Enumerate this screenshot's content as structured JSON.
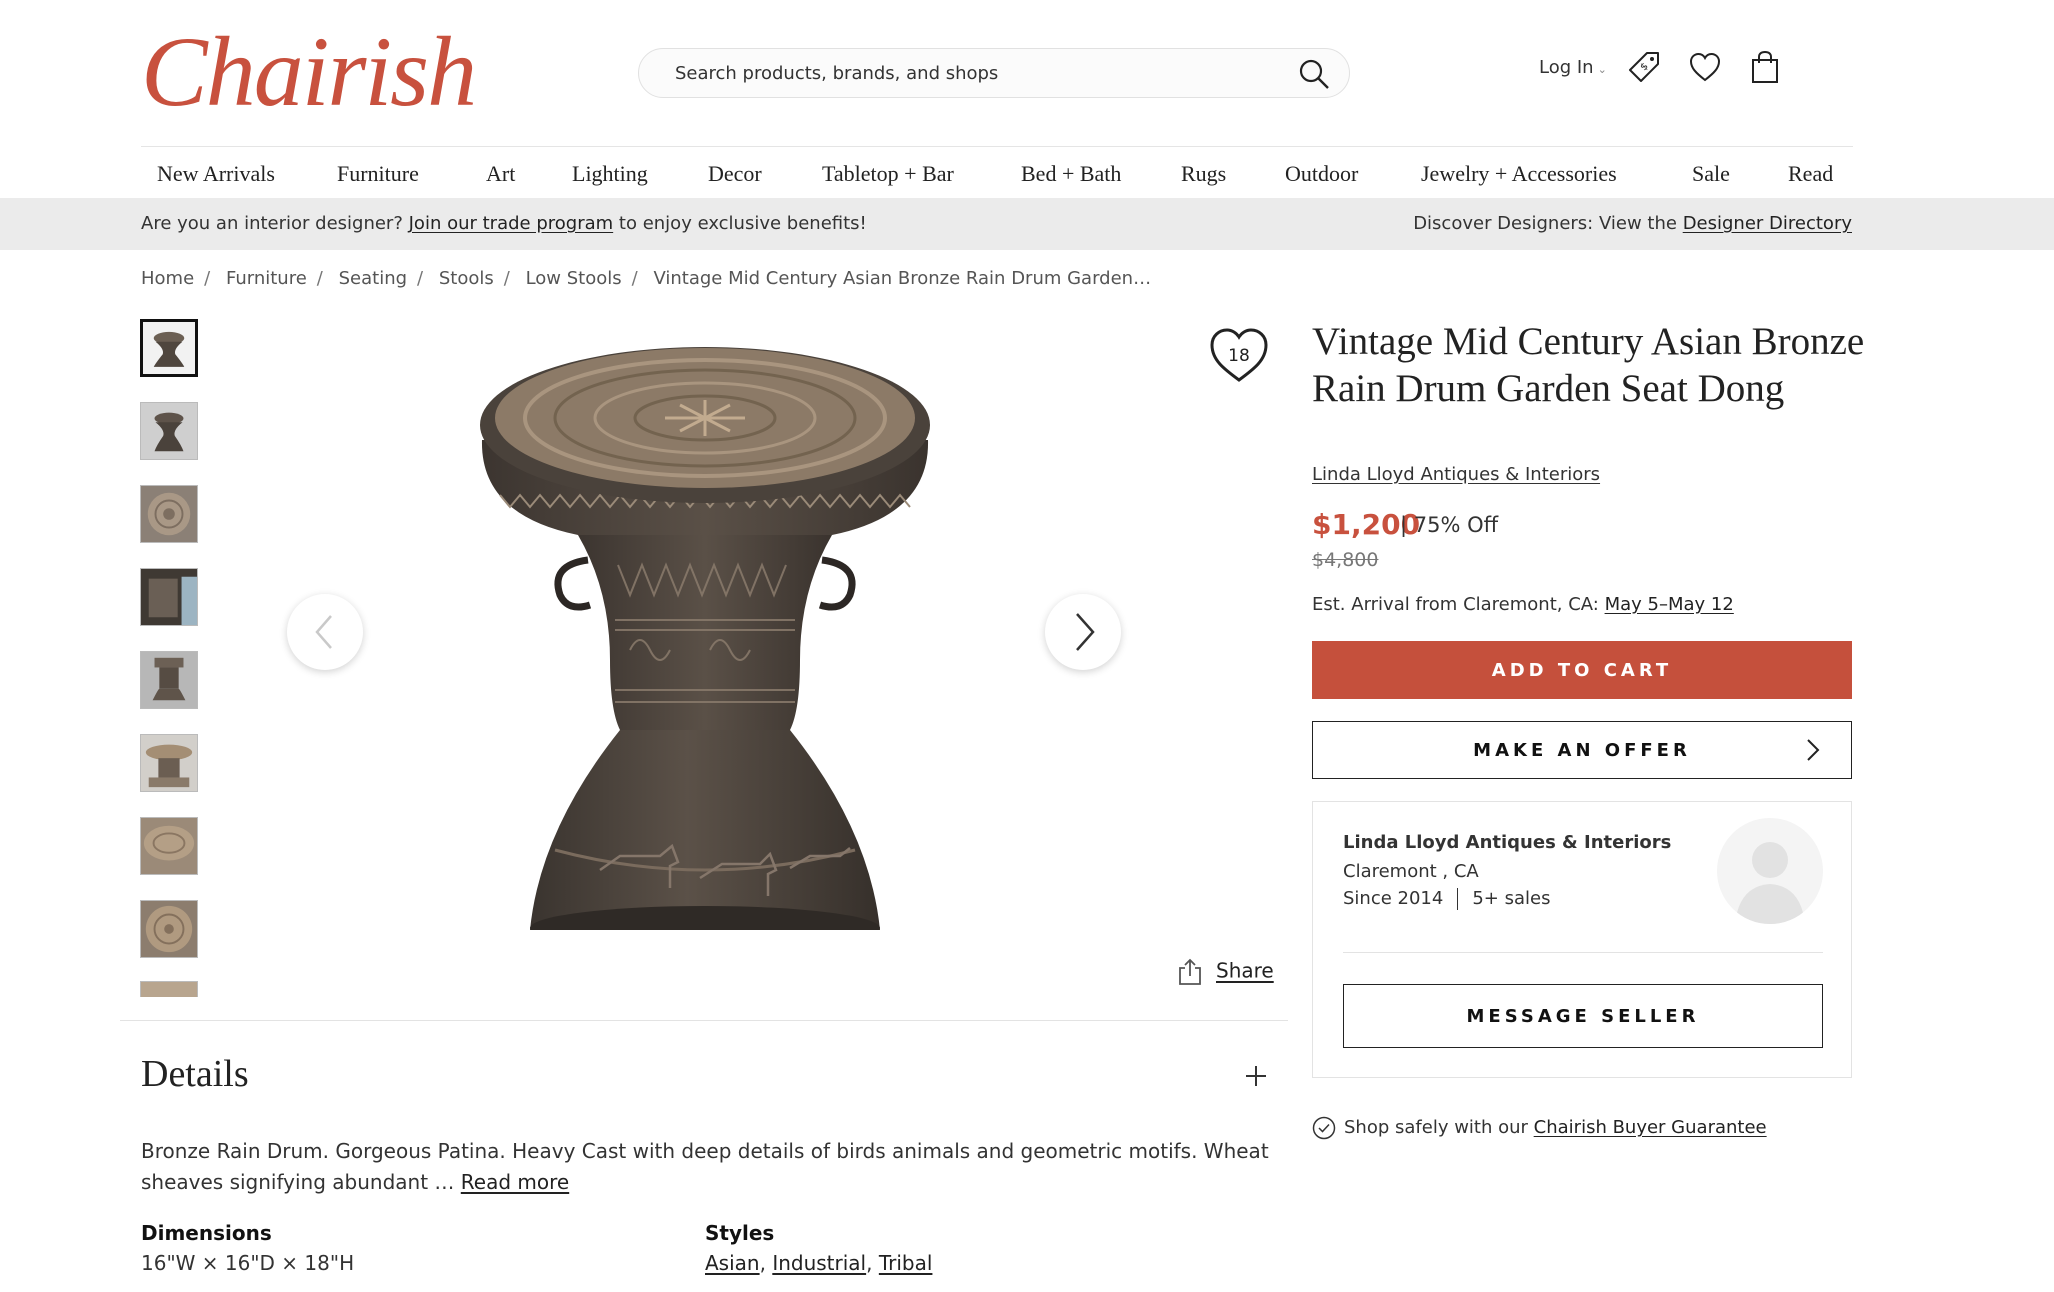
{
  "brand": {
    "logo_text": "Chairish",
    "accent": "#c8513e"
  },
  "header": {
    "search_placeholder": "Search products, brands, and shops",
    "login_label": "Log In",
    "icons": [
      "search-icon",
      "tag-icon",
      "heart-icon",
      "bag-icon"
    ]
  },
  "nav": [
    "New Arrivals",
    "Furniture",
    "Art",
    "Lighting",
    "Decor",
    "Tabletop + Bar",
    "Bed + Bath",
    "Rugs",
    "Outdoor",
    "Jewelry + Accessories",
    "Sale",
    "Read"
  ],
  "banner": {
    "left_prefix": "Are you an interior designer?",
    "left_link": "Join our trade program",
    "left_suffix": "to enjoy exclusive benefits!",
    "right_prefix": "Discover Designers: View the",
    "right_link": "Designer Directory"
  },
  "breadcrumb": [
    "Home",
    "Furniture",
    "Seating",
    "Stools",
    "Low Stools",
    "Vintage Mid Century Asian Bronze Rain Drum Garden…"
  ],
  "gallery": {
    "favorite_count": "18",
    "share_label": "Share",
    "thumbnail_count": 9,
    "active_thumbnail": 1
  },
  "product": {
    "title": "Vintage Mid Century Asian Bronze Rain Drum Garden Seat Dong",
    "seller_link": "Linda Lloyd Antiques & Interiors",
    "price": "$1,200",
    "discount": "| 75% Off",
    "original_price": "$4,800",
    "arrival_prefix": "Est. Arrival from Claremont, CA:",
    "arrival_dates": "May 5–May 12",
    "add_to_cart": "ADD TO CART",
    "make_offer": "MAKE AN OFFER"
  },
  "seller": {
    "name": "Linda Lloyd Antiques & Interiors",
    "location": "Claremont , CA",
    "since": "Since 2014",
    "sales": "5+ sales",
    "message_button": "MESSAGE SELLER"
  },
  "guarantee": {
    "prefix": "Shop safely with our",
    "link": "Chairish Buyer Guarantee"
  },
  "details": {
    "heading": "Details",
    "description": "Bronze Rain Drum. Gorgeous Patina. Heavy Cast with deep details of birds animals and geometric motifs. Wheat sheaves signifying abundant …",
    "read_more": "Read more",
    "dimensions_label": "Dimensions",
    "dimensions_value": "16\"W × 16\"D × 18\"H",
    "styles_label": "Styles",
    "styles": [
      "Asian",
      "Industrial",
      "Tribal"
    ]
  }
}
